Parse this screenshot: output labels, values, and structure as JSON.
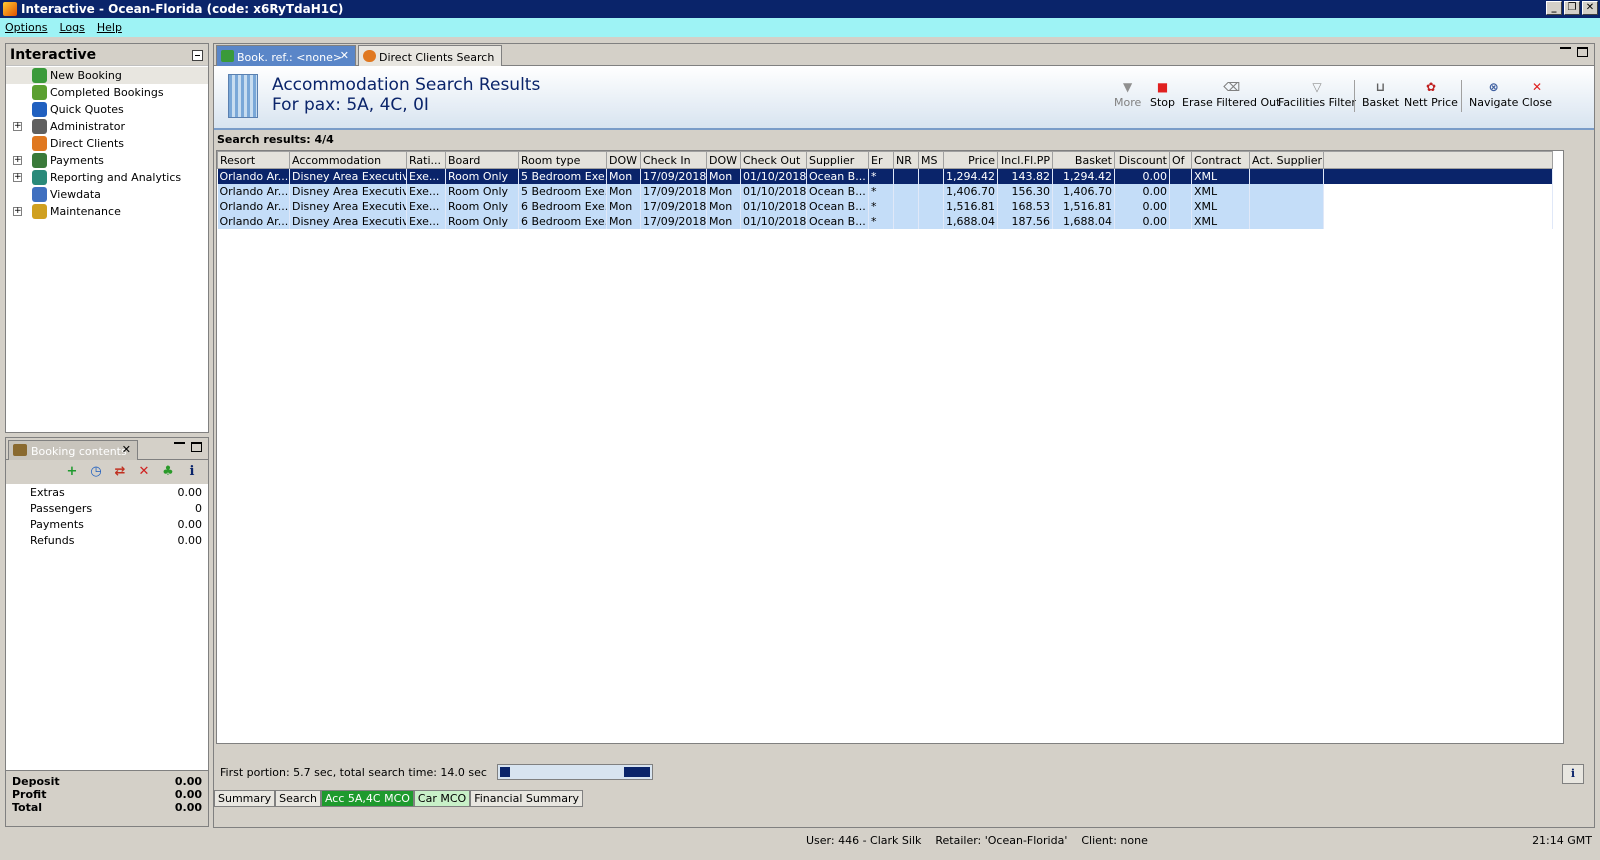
{
  "window": {
    "title": "Interactive - Ocean-Florida (code: x6RyTdaH1C)"
  },
  "menu": [
    "Options",
    "Logs",
    "Help"
  ],
  "nav": {
    "title": "Interactive",
    "items": [
      {
        "label": "New Booking",
        "icon": "palm-icon",
        "expandable": false
      },
      {
        "label": "Completed Bookings",
        "icon": "palm-check-icon",
        "expandable": false
      },
      {
        "label": "Quick Quotes",
        "icon": "clock-icon",
        "expandable": false
      },
      {
        "label": "Administrator",
        "icon": "admin-icon",
        "expandable": true
      },
      {
        "label": "Direct Clients",
        "icon": "client-icon",
        "expandable": false
      },
      {
        "label": "Payments",
        "icon": "payments-icon",
        "expandable": true
      },
      {
        "label": "Reporting and Analytics",
        "icon": "report-icon",
        "expandable": true
      },
      {
        "label": "Viewdata",
        "icon": "globe-icon",
        "expandable": false
      },
      {
        "label": "Maintenance",
        "icon": "maintenance-icon",
        "expandable": true
      }
    ]
  },
  "booking": {
    "tab_label": "Booking contents",
    "lines": [
      {
        "label": "Extras",
        "value": "0.00"
      },
      {
        "label": "Passengers",
        "value": "0"
      },
      {
        "label": "Payments",
        "value": "0.00"
      },
      {
        "label": "Refunds",
        "value": "0.00"
      }
    ],
    "totals": [
      {
        "label": "Deposit",
        "value": "0.00"
      },
      {
        "label": "Profit",
        "value": "0.00"
      },
      {
        "label": "Total",
        "value": "0.00"
      }
    ]
  },
  "tabs": {
    "active": "Book. ref.: <none>",
    "other": "Direct Clients Search"
  },
  "header": {
    "title": "Accommodation Search Results",
    "subtitle": "For pax: 5A, 4C, 0I"
  },
  "toolbar": [
    "More",
    "Stop",
    "Erase Filtered Out",
    "Facilities Filter",
    "Basket",
    "Nett Price",
    "Navigate",
    "Close"
  ],
  "results_label": "Search results: 4/4",
  "columns": [
    "Resort",
    "Accommodation",
    "Rati...",
    "Board",
    "Room type",
    "DOW",
    "Check In",
    "DOW",
    "Check Out",
    "Supplier",
    "Er",
    "NR",
    "MS",
    "Price",
    "Incl.Fl.PP",
    "Basket",
    "Discount",
    "Of",
    "Contract",
    "Act. Supplier"
  ],
  "rows": [
    [
      "Orlando Ar...",
      "Disney Area Executiv...",
      "Exe...",
      "Room Only",
      "5 Bedroom Exe...",
      "Mon",
      "17/09/2018",
      "Mon",
      "01/10/2018",
      "Ocean B...",
      "*",
      "",
      "",
      "1,294.42",
      "143.82",
      "1,294.42",
      "0.00",
      "",
      "XML",
      ""
    ],
    [
      "Orlando Ar...",
      "Disney Area Executiv...",
      "Exe...",
      "Room Only",
      "5 Bedroom Exe...",
      "Mon",
      "17/09/2018",
      "Mon",
      "01/10/2018",
      "Ocean B...",
      "*",
      "",
      "",
      "1,406.70",
      "156.30",
      "1,406.70",
      "0.00",
      "",
      "XML",
      ""
    ],
    [
      "Orlando Ar...",
      "Disney Area Executiv...",
      "Exe...",
      "Room Only",
      "6 Bedroom Exe...",
      "Mon",
      "17/09/2018",
      "Mon",
      "01/10/2018",
      "Ocean B...",
      "*",
      "",
      "",
      "1,516.81",
      "168.53",
      "1,516.81",
      "0.00",
      "",
      "XML",
      ""
    ],
    [
      "Orlando Ar...",
      "Disney Area Executiv...",
      "Exe...",
      "Room Only",
      "6 Bedroom Exe...",
      "Mon",
      "17/09/2018",
      "Mon",
      "01/10/2018",
      "Ocean B...",
      "*",
      "",
      "",
      "1,688.04",
      "187.56",
      "1,688.04",
      "0.00",
      "",
      "XML",
      ""
    ]
  ],
  "status": {
    "search_time": "First portion: 5.7 sec, total search time: 14.0 sec"
  },
  "bottom_tabs": [
    "Summary",
    "Search",
    "Acc 5A,4C MCO",
    "Car MCO",
    "Financial Summary"
  ],
  "statusbar": {
    "user": "User: 446 - Clark Silk    Retailer: 'Ocean-Florida'    Client: none",
    "time": "21:14 GMT"
  },
  "colors": {
    "title_bar": "#0a246a",
    "menu_bar": "#9ef3f5",
    "row_bg": "#c4ddf8",
    "selected_row": "#0a246a",
    "active_tab_green": "#1e9a2e"
  }
}
